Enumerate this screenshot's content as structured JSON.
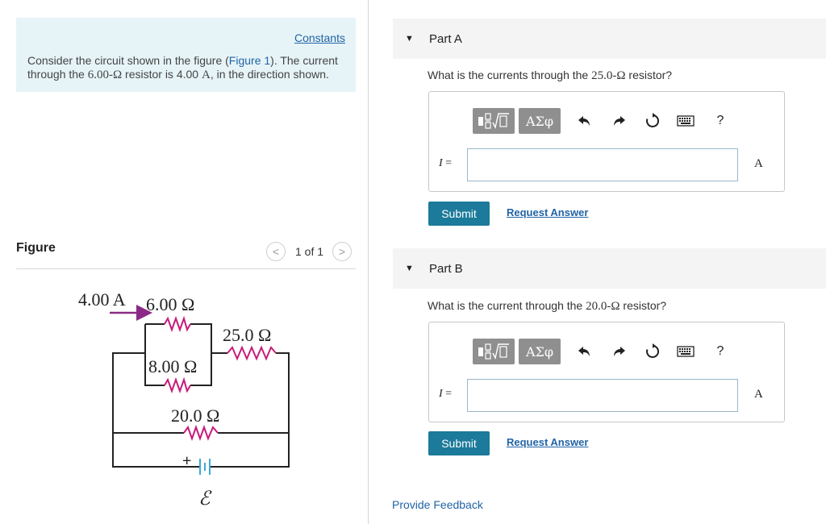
{
  "problem": {
    "constants_link": "Constants",
    "text_before": "Consider the circuit shown in the figure (",
    "figure_link": "Figure 1",
    "text_mid": "). The current through the ",
    "resistor_value": "6.00-Ω",
    "text_mid2": " resistor is 4.00 ",
    "current_unit": "A",
    "text_after": ", in the direction shown."
  },
  "figure": {
    "label": "Figure",
    "pager_text": "1 of 1",
    "prev_glyph": "<",
    "next_glyph": ">",
    "circuit": {
      "current_label": "4.00 A",
      "r1_label": "6.00 Ω",
      "r2_label": "25.0 Ω",
      "r3_label": "8.00 Ω",
      "r4_label": "20.0 Ω",
      "plus_sign": "+",
      "emf_label": "ℰ",
      "wire_color": "#222222",
      "resistor_color": "#c8197a",
      "arrow_color": "#8a2a86",
      "battery_color": "#3aa9d9"
    }
  },
  "parts": [
    {
      "title": "Part A",
      "question_before": "What is the currents through the ",
      "resistor": "25.0-Ω",
      "question_after": " resistor?",
      "answer_label": "I",
      "answer_eq": " =",
      "answer_value": "",
      "unit": "A",
      "submit_label": "Submit",
      "request_label": "Request Answer"
    },
    {
      "title": "Part B",
      "question_before": "What is the current through the ",
      "resistor": "20.0-Ω",
      "question_after": " resistor?",
      "answer_label": "I",
      "answer_eq": " =",
      "answer_value": "",
      "unit": "A",
      "submit_label": "Submit",
      "request_label": "Request Answer"
    }
  ],
  "toolbar": {
    "greek_label": "ΑΣφ",
    "help_label": "?",
    "icons": [
      "template-icon",
      "greek-symbols",
      "undo-icon",
      "redo-icon",
      "reset-icon",
      "keyboard-icon",
      "help-icon"
    ]
  },
  "feedback_link": "Provide Feedback",
  "colors": {
    "accent": "#1c7a9a",
    "link": "#2264a6",
    "info_bg": "#e6f4f7"
  }
}
